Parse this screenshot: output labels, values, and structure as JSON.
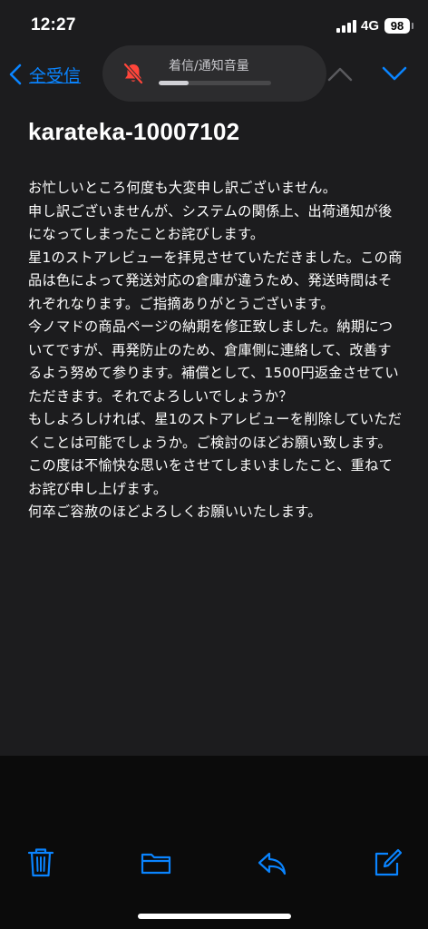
{
  "status_bar": {
    "time": "12:27",
    "network": "4G",
    "battery": "98"
  },
  "nav": {
    "back_label": "全受信"
  },
  "volume_hud": {
    "label": "着信/通知音量",
    "level": 0.27,
    "muted": true
  },
  "message": {
    "sender": "karateka-10007102",
    "paragraphs": [
      "お忙しいところ何度も大変申し訳ございません。",
      "申し訳ございませんが、システムの関係上、出荷通知が後になってしまったことお詫びします。",
      "星1のストアレビューを拝見させていただきました。この商品は色によって発送対応の倉庫が違うため、発送時間はそれぞれなります。ご指摘ありがとうございます。",
      "今ノマドの商品ページの納期を修正致しました。納期についてですが、再発防止のため、倉庫側に連絡して、改善するよう努めて参ります。補償として、1500円返金させていただきます。それでよろしいでしょうか？",
      "もしよろしければ、星1のストアレビューを削除していただくことは可能でしょうか。ご検討のほどお願い致します。",
      "この度は不愉快な思いをさせてしまいましたこと、重ねてお詫び申し上げます。",
      "何卒ご容赦のほどよろしくお願いいたします。"
    ]
  },
  "toolbar": {
    "icons": [
      "trash-icon",
      "folder-icon",
      "reply-icon",
      "compose-icon"
    ]
  },
  "colors": {
    "accent": "#0a84ff",
    "background": "#1c1c1e",
    "toolbar_background": "#0b0b0b",
    "muted_bell": "#ff453a"
  }
}
